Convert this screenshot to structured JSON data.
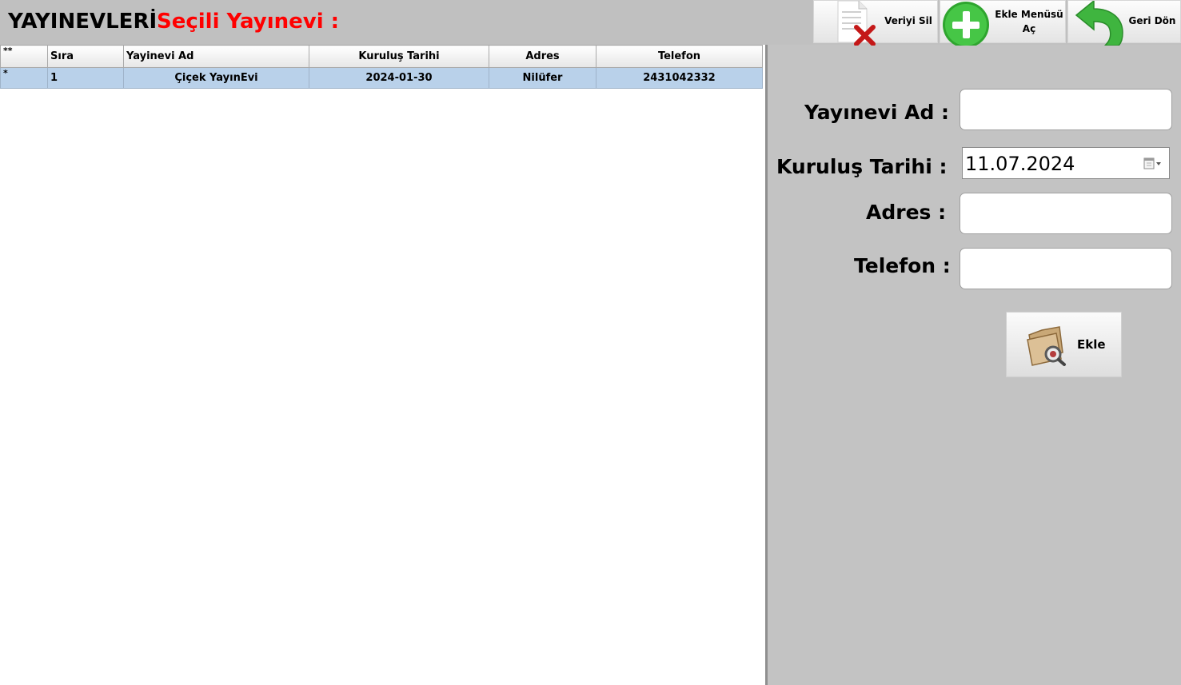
{
  "header": {
    "title": "YAYINEVLERİ",
    "selected_label": "Seçili Yayınevi :"
  },
  "toolbar": {
    "delete_label": "Veriyi Sil",
    "add_menu_line1": "Ekle Menüsü",
    "add_menu_line2": "Aç",
    "back_label": "Geri Dön",
    "delete_icon": "document-delete-icon",
    "add_icon": "green-plus-icon",
    "back_icon": "green-back-arrow-icon"
  },
  "grid": {
    "columns": [
      "**",
      "Sıra",
      "Yayinevi Ad",
      "Kuruluş Tarihi",
      "Adres",
      "Telefon"
    ],
    "rows": [
      {
        "marker": "*",
        "sira": "1",
        "ad": "Çiçek YayınEvi",
        "tarih": "2024-01-30",
        "adres": "Nilüfer",
        "telefon": "2431042332"
      }
    ]
  },
  "form": {
    "ad_label": "Yayınevi Ad :",
    "tarih_label": "Kuruluş Tarihi  :",
    "tarih_value": "11.07.2024",
    "adres_label": "Adres :",
    "telefon_label": "Telefon :",
    "ad_value": "",
    "adres_value": "",
    "telefon_value": "",
    "ekle_label": "Ekle",
    "ekle_icon": "folder-search-icon"
  },
  "colors": {
    "accent_red": "#ff0000",
    "selection": "#b9d1ea",
    "background": "#c3c3c3"
  }
}
